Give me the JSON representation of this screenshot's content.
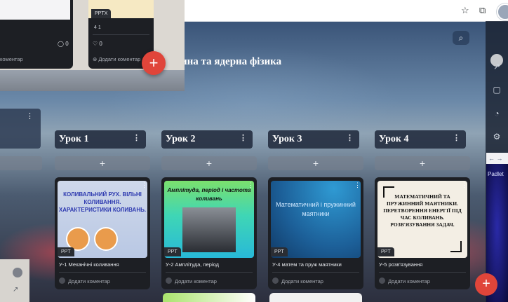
{
  "board": {
    "title": "ина та ядерна фізика"
  },
  "columns": [
    {
      "title": "Урок 1"
    },
    {
      "title": "Урок 2"
    },
    {
      "title": "Урок 3"
    },
    {
      "title": "Урок 4"
    }
  ],
  "add_symbol": "+",
  "kebab": "⋮",
  "cards": [
    {
      "tag": "PPT",
      "title": "У-1 Механічні коливання",
      "comment": "Додати коментар",
      "thumb": "КОЛИВАЛЬНИЙ РУХ. ВІЛЬНІ КОЛИВАННЯ. ХАРАКТЕРИСТИКИ КОЛИВАНЬ."
    },
    {
      "tag": "PPT",
      "title": "У-2 Амплітуда, період",
      "comment": "Додати коментар",
      "thumb": "Амплітуда, період і частота коливань"
    },
    {
      "tag": "PPT",
      "title": "У-4 матем та пруж маятники",
      "comment": "Додати коментар",
      "thumb": "Математичний і пружинний маятники"
    },
    {
      "tag": "PPT",
      "title": "У-5 розв'язування",
      "comment": "Додати коментар",
      "thumb": "МАТЕМАТИЧНИЙ ТА ПРУЖИННИЙ МАЯТНИКИ. ПЕРЕТВОРЕННЯ ЕНЕРГІЇ ПІД ЧАС КОЛИВАНЬ. РОЗВ'ЯЗУВАННЯ ЗАДАЧ."
    }
  ],
  "overlay": {
    "card1": {
      "comment_count": "0",
      "comment": "коментар"
    },
    "card2": {
      "tag": "PPTX",
      "meta": "4 1",
      "likes": "0",
      "comment": "Додати коментар"
    },
    "fab": "+"
  },
  "right_overlay": {
    "logo": "Padlet"
  },
  "icons": {
    "search": "search-icon",
    "star": "star-icon",
    "extensions": "puzzle-icon"
  }
}
